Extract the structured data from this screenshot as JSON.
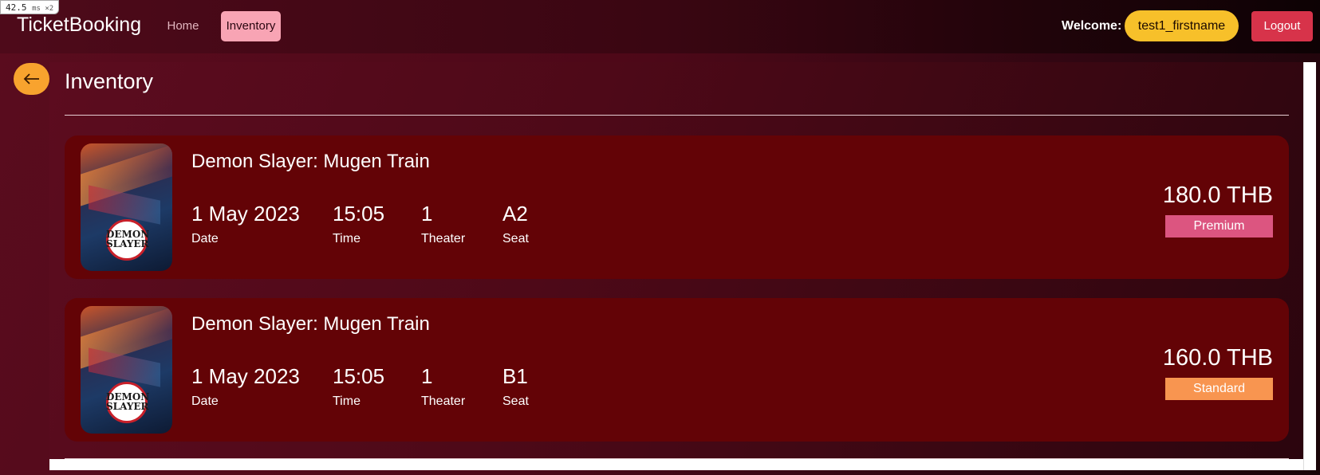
{
  "debug_overlay": {
    "value": "42.5",
    "unit": "ms ×2"
  },
  "navbar": {
    "brand": "TicketBooking",
    "links": [
      {
        "label": "Home",
        "active": false
      },
      {
        "label": "Inventory",
        "active": true
      }
    ],
    "welcome_label": "Welcome:",
    "username": "test1_firstname",
    "logout_label": "Logout"
  },
  "page": {
    "back_icon": "arrow-left-icon",
    "title": "Inventory"
  },
  "tickets": [
    {
      "movie_title": "Demon Slayer: Mugen Train",
      "poster_label": "DEMON SLAYER",
      "date": "1 May 2023",
      "date_label": "Date",
      "time": "15:05",
      "time_label": "Time",
      "theater": "1",
      "theater_label": "Theater",
      "seat": "A2",
      "seat_label": "Seat",
      "price": "180.0 THB",
      "tier": "Premium",
      "tier_color": "#dc5580"
    },
    {
      "movie_title": "Demon Slayer: Mugen Train",
      "poster_label": "DEMON SLAYER",
      "date": "1 May 2023",
      "date_label": "Date",
      "time": "15:05",
      "time_label": "Time",
      "theater": "1",
      "theater_label": "Theater",
      "seat": "B1",
      "seat_label": "Seat",
      "price": "160.0 THB",
      "tier": "Standard",
      "tier_color": "#f89550"
    }
  ],
  "colors": {
    "accent_yellow": "#f7c02a",
    "back_orange": "#f8a32e",
    "logout_red": "#d7334a",
    "card_bg": "#630306",
    "active_nav": "#f8a4b4"
  }
}
